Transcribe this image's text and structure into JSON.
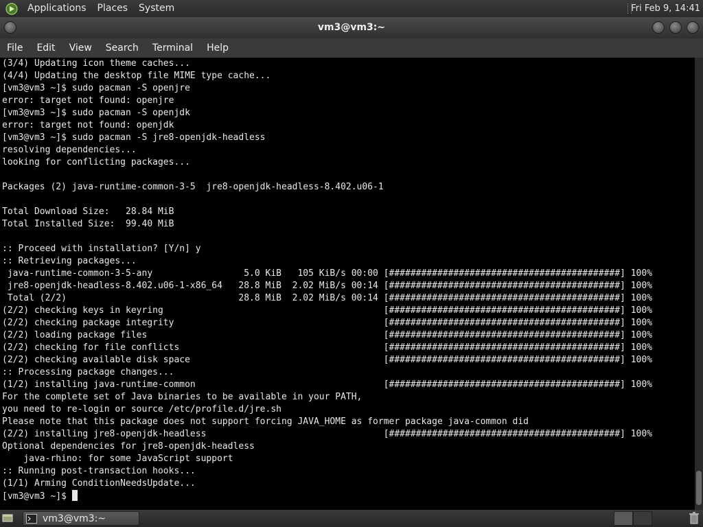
{
  "top_panel": {
    "menus": [
      "Applications",
      "Places",
      "System"
    ],
    "clock": "Fri Feb  9, 14:41"
  },
  "window": {
    "title": "vm3@vm3:~"
  },
  "menubar": {
    "items": [
      "File",
      "Edit",
      "View",
      "Search",
      "Terminal",
      "Help"
    ]
  },
  "terminal": {
    "lines": [
      "(3/4) Updating icon theme caches...",
      "(4/4) Updating the desktop file MIME type cache...",
      "[vm3@vm3 ~]$ sudo pacman -S openjre",
      "error: target not found: openjre",
      "[vm3@vm3 ~]$ sudo pacman -S openjdk",
      "error: target not found: openjdk",
      "[vm3@vm3 ~]$ sudo pacman -S jre8-openjdk-headless",
      "resolving dependencies...",
      "looking for conflicting packages...",
      "",
      "Packages (2) java-runtime-common-3-5  jre8-openjdk-headless-8.402.u06-1",
      "",
      "Total Download Size:   28.84 MiB",
      "Total Installed Size:  99.40 MiB",
      "",
      ":: Proceed with installation? [Y/n] y",
      ":: Retrieving packages...",
      " java-runtime-common-3-5-any                 5.0 KiB   105 KiB/s 00:00 [###########################################] 100%",
      " jre8-openjdk-headless-8.402.u06-1-x86_64   28.8 MiB  2.02 MiB/s 00:14 [###########################################] 100%",
      " Total (2/2)                                28.8 MiB  2.02 MiB/s 00:14 [###########################################] 100%",
      "(2/2) checking keys in keyring                                         [###########################################] 100%",
      "(2/2) checking package integrity                                       [###########################################] 100%",
      "(2/2) loading package files                                            [###########################################] 100%",
      "(2/2) checking for file conflicts                                      [###########################################] 100%",
      "(2/2) checking available disk space                                    [###########################################] 100%",
      ":: Processing package changes...",
      "(1/2) installing java-runtime-common                                   [###########################################] 100%",
      "For the complete set of Java binaries to be available in your PATH,",
      "you need to re-login or source /etc/profile.d/jre.sh",
      "Please note that this package does not support forcing JAVA_HOME as former package java-common did",
      "(2/2) installing jre8-openjdk-headless                                 [###########################################] 100%",
      "Optional dependencies for jre8-openjdk-headless",
      "    java-rhino: for some JavaScript support",
      ":: Running post-transaction hooks...",
      "(1/1) Arming ConditionNeedsUpdate...",
      "[vm3@vm3 ~]$ "
    ]
  },
  "taskbar": {
    "task_label": "vm3@vm3:~"
  }
}
